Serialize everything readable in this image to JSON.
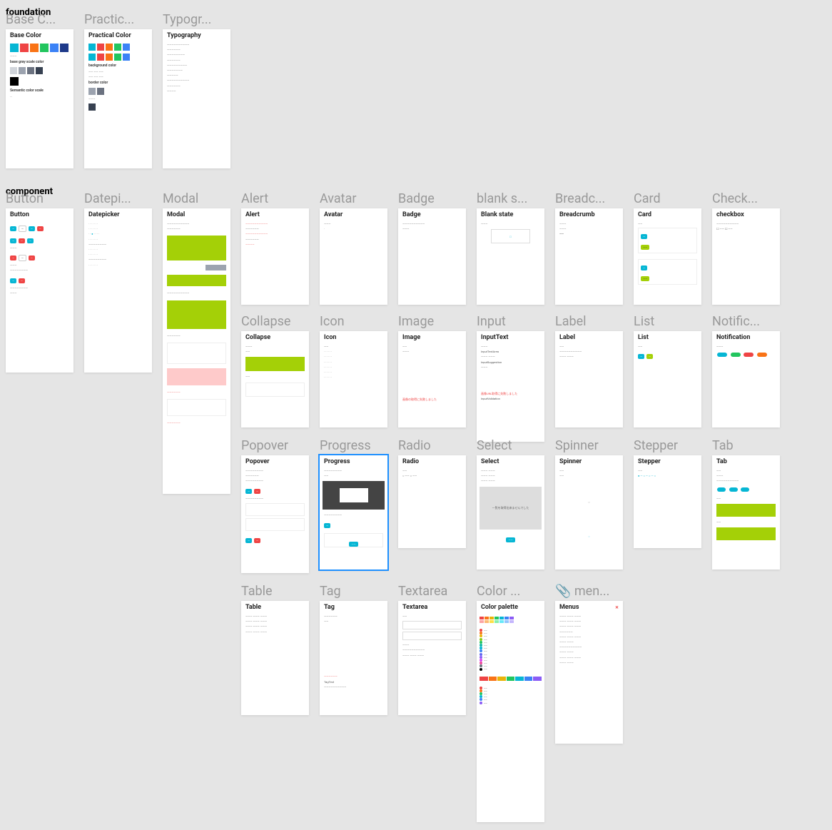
{
  "sections": {
    "foundation": "foundation",
    "component": "component"
  },
  "frames": {
    "foundation": [
      {
        "id": "base-color",
        "title": "Base C...",
        "header": "Base Color"
      },
      {
        "id": "practical-color",
        "title": "Practic...",
        "header": "Practical Color"
      },
      {
        "id": "typography",
        "title": "Typogr...",
        "header": "Typography"
      }
    ],
    "component_row1": [
      {
        "id": "button",
        "title": "Button",
        "header": "Button"
      },
      {
        "id": "datepicker",
        "title": "Datepi...",
        "header": "Datepicker"
      },
      {
        "id": "modal",
        "title": "Modal",
        "header": "Modal"
      },
      {
        "id": "alert",
        "title": "Alert",
        "header": "Alert"
      },
      {
        "id": "avatar",
        "title": "Avatar",
        "header": "Avatar"
      },
      {
        "id": "badge",
        "title": "Badge",
        "header": "Badge"
      },
      {
        "id": "blank-state",
        "title": "blank s...",
        "header": "Blank state"
      },
      {
        "id": "breadcrumb",
        "title": "Breadc...",
        "header": "Breadcrumb"
      },
      {
        "id": "card",
        "title": "Card",
        "header": "Card"
      },
      {
        "id": "checkbox",
        "title": "Check...",
        "header": "checkbox"
      }
    ],
    "component_row2": [
      {
        "id": "collapse",
        "title": "Collapse",
        "header": "Collapse"
      },
      {
        "id": "icon",
        "title": "Icon",
        "header": "Icon"
      },
      {
        "id": "image",
        "title": "Image",
        "header": "Image"
      },
      {
        "id": "input",
        "title": "Input",
        "header": "InputText"
      },
      {
        "id": "label",
        "title": "Label",
        "header": "Label"
      },
      {
        "id": "list",
        "title": "List",
        "header": "List"
      },
      {
        "id": "notification",
        "title": "Notific...",
        "header": "Notification"
      }
    ],
    "component_row3": [
      {
        "id": "popover",
        "title": "Popover",
        "header": "Popover"
      },
      {
        "id": "progress",
        "title": "Progress",
        "header": "Progress"
      },
      {
        "id": "radio",
        "title": "Radio",
        "header": "Radio"
      },
      {
        "id": "select",
        "title": "Select",
        "header": "Select"
      },
      {
        "id": "spinner",
        "title": "Spinner",
        "header": "Spinner"
      },
      {
        "id": "stepper",
        "title": "Stepper",
        "header": "Stepper"
      },
      {
        "id": "tab",
        "title": "Tab",
        "header": "Tab"
      }
    ],
    "component_row4": [
      {
        "id": "table",
        "title": "Table",
        "header": "Table"
      },
      {
        "id": "tag",
        "title": "Tag",
        "header": "Tag"
      },
      {
        "id": "textarea",
        "title": "Textarea",
        "header": "Textarea"
      },
      {
        "id": "color-palette",
        "title": "Color ...",
        "header": "Color palette"
      },
      {
        "id": "menus",
        "title": "📎 men...",
        "header": "Menus"
      }
    ]
  },
  "swatches": {
    "base_primary": [
      "#06b6d4",
      "#ef4444",
      "#f97316",
      "#22c55e",
      "#3b82f6",
      "#1e3a8a"
    ],
    "base_grays": [
      "#d1d5db",
      "#9ca3af",
      "#6b7280",
      "#374151"
    ],
    "practical": [
      "#06b6d4",
      "#ef4444",
      "#f97316",
      "#22c55e",
      "#3b82f6",
      "#06b6d4",
      "#ef4444",
      "#f97316",
      "#22c55e",
      "#3b82f6"
    ]
  },
  "labels": {
    "base_gray_label": "base gray scale color",
    "base_semantic": "Semantic color scale",
    "background": "background color",
    "border": "border color",
    "image_error": "画像の取得に失敗しました",
    "input_error": "画像URL取得に失敗しました",
    "input_validation": "InputValidation",
    "tag_text": "TagText",
    "select_empty": "一覧を取得出来ませんでした"
  }
}
